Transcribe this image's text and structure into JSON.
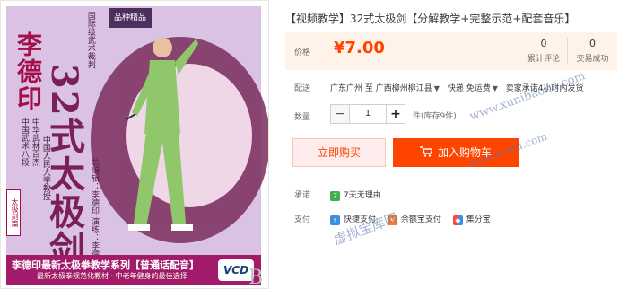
{
  "product": {
    "title": "【视频教学】32式太极剑【分解教学+完整示范+配套音乐】",
    "image": {
      "author": "李德印",
      "title": "32式太极剑",
      "subtitle_lines": [
        "中国武术八段",
        "中华武林百杰",
        "中国人民大学教授",
        "国际级武术裁判"
      ],
      "side_text": "总编辑：李德印 演练：李德印",
      "corner_tag": "品种精品",
      "ribbon_tag": "太极剑篇",
      "band_line1": "李德印最新太极拳教学系列【普通话配音】",
      "band_line2": "最新太极拳规范化教材 · 中老年健身的最佳选择",
      "vcd": "VCD",
      "logo_letter": "B"
    }
  },
  "price": {
    "label": "价格",
    "value": "¥7.00",
    "reviews_count": "0",
    "reviews_label": "累计评论",
    "sales_count": "0",
    "sales_label": "交易成功"
  },
  "shipping": {
    "label": "配送",
    "from": "广东广州",
    "to_word": "至",
    "to": "广西柳州柳江县",
    "express": "快递 免运费",
    "promise": "卖家承诺4小时内发货"
  },
  "quantity": {
    "label": "数量",
    "minus": "−",
    "value": "1",
    "plus": "+",
    "stock": "件(库存9件)"
  },
  "actions": {
    "buy_now": "立即购买",
    "add_cart": "加入购物车"
  },
  "promise": {
    "label": "承诺",
    "badge": "7",
    "text": "7天无理由"
  },
  "payment": {
    "label": "支付",
    "methods": [
      "快捷支付",
      "余额宝支付",
      "集分宝"
    ]
  },
  "watermark": {
    "url": "www.xunibaoku.com",
    "url2": "xunibaoku.com",
    "site": "虚拟宝库网"
  },
  "colors": {
    "accent": "#ff4400",
    "price_bg": "#fff2e8"
  }
}
